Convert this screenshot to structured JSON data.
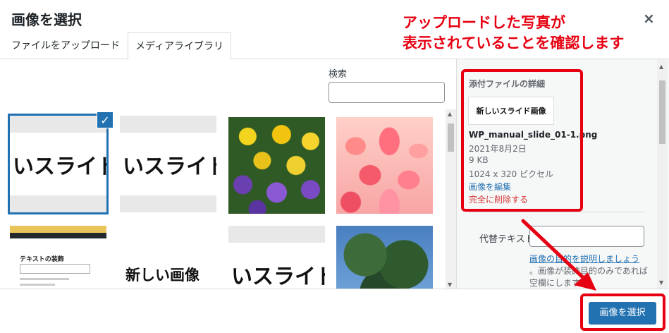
{
  "dialog": {
    "title": "画像を選択",
    "close_glyph": "×"
  },
  "tabs": [
    {
      "label": "ファイルをアップロード"
    },
    {
      "label": "メディアライブラリ"
    }
  ],
  "search": {
    "label": "検索",
    "value": ""
  },
  "thumbnails": [
    {
      "kind": "slide",
      "text": "いスライド",
      "selected": true
    },
    {
      "kind": "slide",
      "text": "いスライド",
      "selected": false
    },
    {
      "kind": "photo",
      "subject": "pansies",
      "selected": false
    },
    {
      "kind": "photo",
      "subject": "tulips",
      "selected": false
    },
    {
      "kind": "screenshot",
      "text": "テキストの装飾",
      "selected": false
    },
    {
      "kind": "slide",
      "text": "新しい画像",
      "selected": false
    },
    {
      "kind": "slide",
      "text": "いスライド",
      "selected": false
    },
    {
      "kind": "photo",
      "subject": "tree",
      "selected": false
    }
  ],
  "check_glyph": "✓",
  "details": {
    "heading": "添付ファイルの詳細",
    "thumb_text": "新しいスライド画像",
    "filename": "WP_manual_slide_01-1.png",
    "date": "2021年8月2日",
    "filesize": "9 KB",
    "dimensions": "1024 x 320 ピクセル",
    "edit_link": "画像を編集",
    "delete_link": "完全に削除する",
    "alt_label": "代替テキスト",
    "alt_value": "",
    "alt_link": "画像の目的を説明しましょう",
    "alt_help": "。画像が装飾目的のみであれば空欄にします。"
  },
  "toolbar": {
    "select_button": "画像を選択"
  },
  "annotation": {
    "line1": "アップロードした写真が",
    "line2": "表示されていることを確認します",
    "color": "#e60012"
  },
  "colors": {
    "accent": "#2271b1",
    "danger": "#d63638"
  }
}
